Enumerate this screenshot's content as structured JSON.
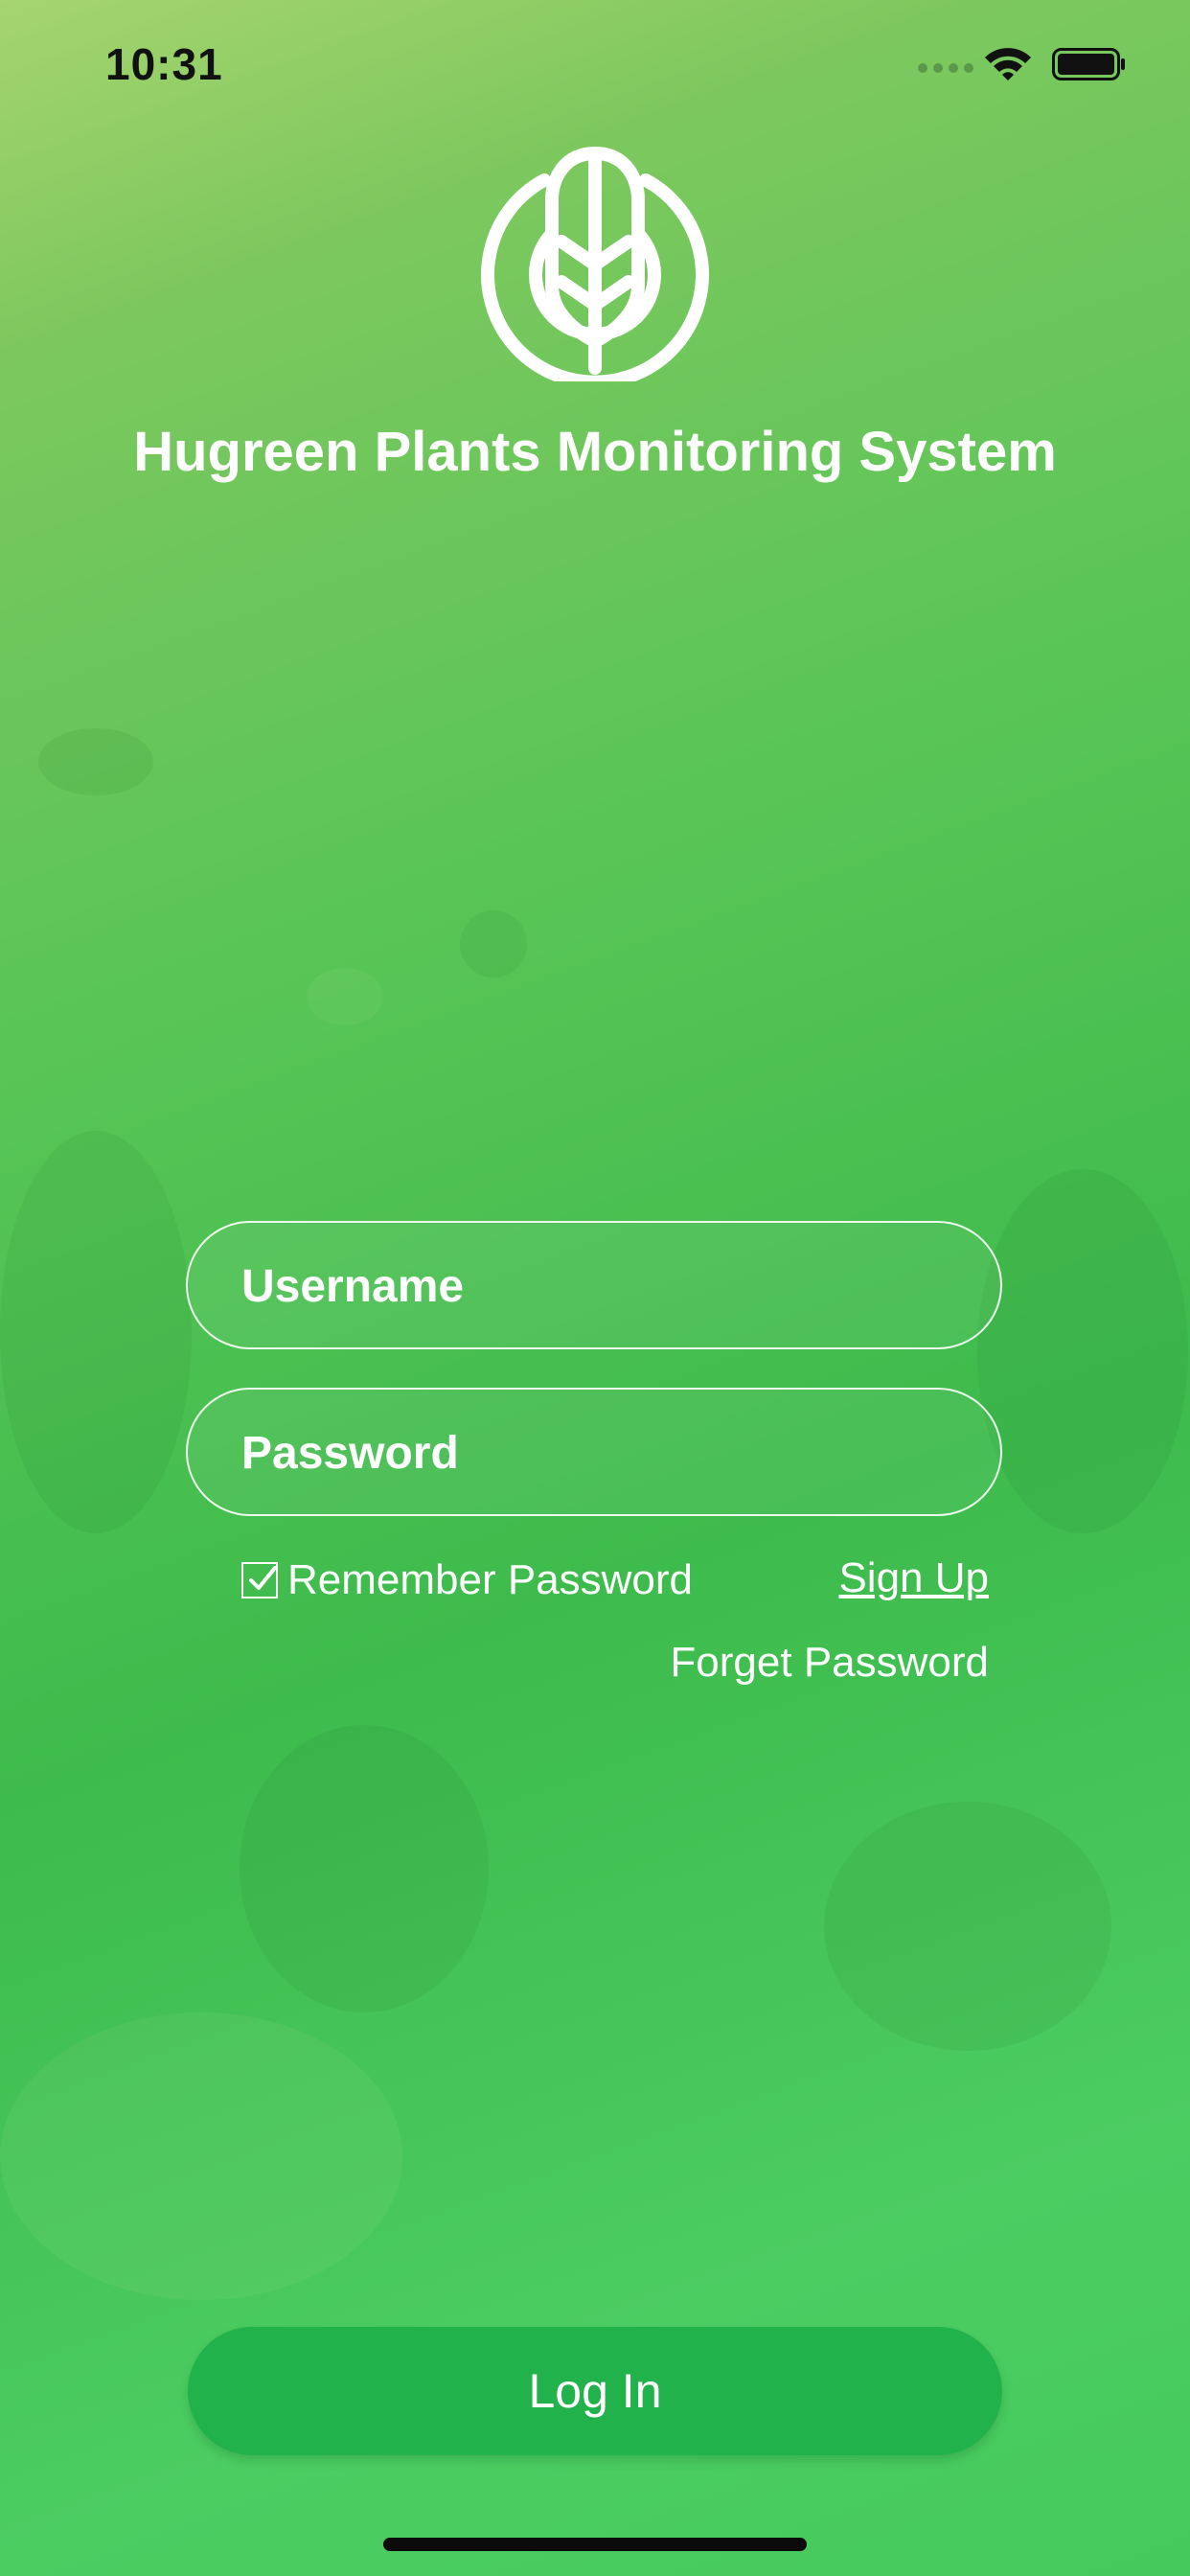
{
  "status_bar": {
    "time": "10:31",
    "icons": [
      "cellular-signal-icon",
      "wifi-icon",
      "battery-icon"
    ]
  },
  "app": {
    "logo": "wheat-leaf-logo-icon",
    "title": "Hugreen Plants Monitoring System"
  },
  "form": {
    "username_placeholder": "Username",
    "username_value": "",
    "password_placeholder": "Password",
    "password_value": "",
    "remember_label": "Remember Password",
    "remember_checked": true,
    "signup_label": "Sign Up",
    "forget_label": "Forget Password",
    "login_label": "Log In"
  },
  "colors": {
    "background_top": "#a6d46e",
    "background_bottom": "#45c95c",
    "button": "#22b24b",
    "text": "#ffffff"
  }
}
